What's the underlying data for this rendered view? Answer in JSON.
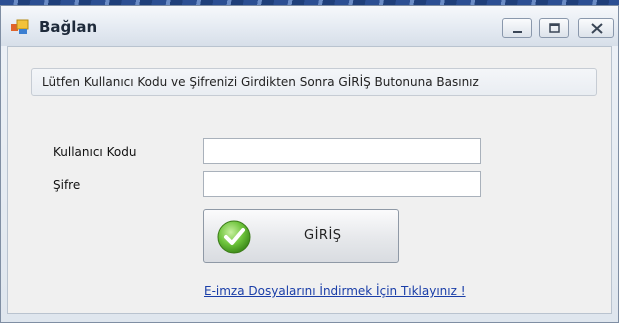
{
  "window": {
    "title": "Bağlan",
    "controls": [
      "minimize-icon",
      "maximize-icon",
      "close-icon"
    ]
  },
  "banner": {
    "text": "Lütfen Kullanıcı Kodu ve Şifrenizi Girdikten Sonra GİRİŞ Butonuna Basınız"
  },
  "form": {
    "user_label": "Kullanıcı Kodu",
    "user_value": "",
    "password_label": "Şifre",
    "password_value": "",
    "login_label": "GİRİŞ",
    "login_icon": "check-icon"
  },
  "link": {
    "text": "E-imza Dosyalarını İndirmek İçin Tıklayınız !"
  },
  "colors": {
    "link": "#1a3ea8",
    "check_green": "#5fb82e"
  }
}
